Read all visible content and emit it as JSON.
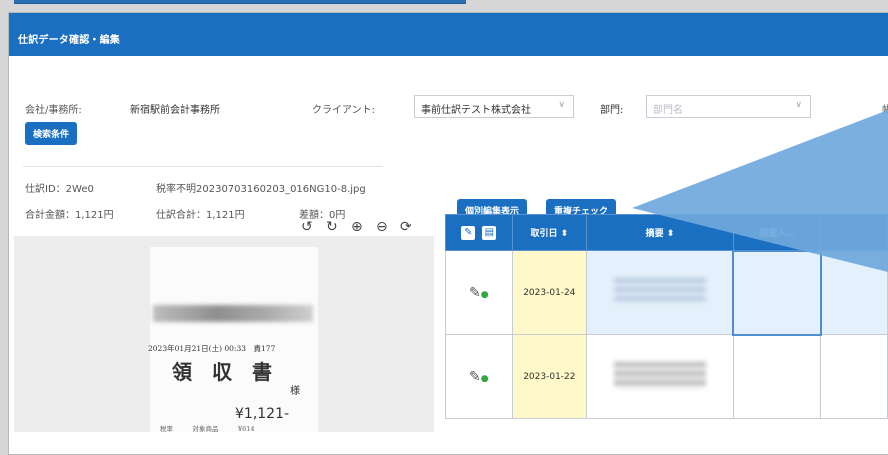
{
  "page": {
    "title": "仕訳データ確認・編集"
  },
  "filters": {
    "office_label": "会社/事務所:",
    "office_value": "新宿駅前会計事務所",
    "client_label": "クライアント:",
    "client_value": "事前仕訳テスト株式会社",
    "dept_label": "部門:",
    "dept_placeholder": "部門名",
    "cut_label": "帳",
    "search_button": "検索条件"
  },
  "journal": {
    "id_text": "仕訳ID：2We0",
    "filename": "税率不明20230703160203_016NG10-8.jpg",
    "total_amount": "合計金額：1,121円",
    "journal_total": "仕訳合計：1,121円",
    "difference": "差額：0円"
  },
  "receipt": {
    "datetime": "2023年01月21日(土) 00:33　責177",
    "title": "領　収　書",
    "honorific": "様",
    "amount": "¥1,121-",
    "footer": "税率　　　対象商品　　　¥614"
  },
  "toolbar": {
    "individual_edit": "個別編集表示",
    "duplicate_check": "重複チェック"
  },
  "table": {
    "columns": [
      "取引日 ⬍",
      "摘要 ⬍",
      "摘要入…"
    ],
    "rows": [
      {
        "date": "2023-01-24"
      },
      {
        "date": "2023-01-22"
      }
    ]
  },
  "colors": {
    "header_blue": "#1b6fc1",
    "callout_blue": "#6fa8dc",
    "date_cell": "#fff8c8"
  }
}
